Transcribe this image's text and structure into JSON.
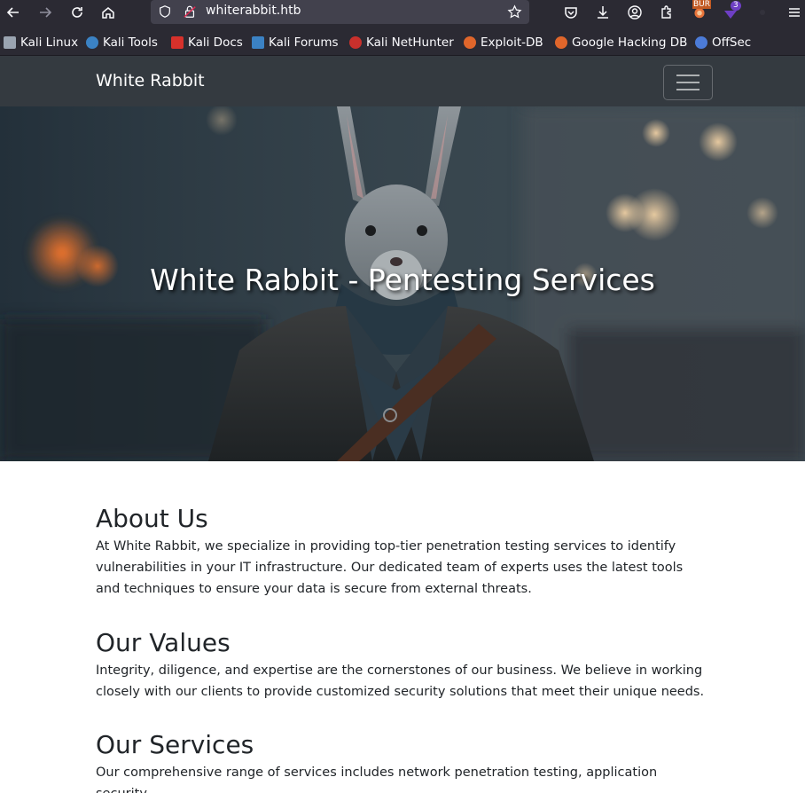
{
  "browser": {
    "url": "whiterabbit.htb",
    "extension_badge_count": "3",
    "burp_label": "BUR"
  },
  "bookmarks": [
    {
      "label": "Kali Linux",
      "icon": "kali-dragon-icon",
      "color": "#9aa4b1"
    },
    {
      "label": "Kali Tools",
      "icon": "kali-tools-icon",
      "color": "#3b82c4"
    },
    {
      "label": "Kali Docs",
      "icon": "kali-docs-icon",
      "color": "#d6312b"
    },
    {
      "label": "Kali Forums",
      "icon": "kali-forums-icon",
      "color": "#3b82c4"
    },
    {
      "label": "Kali NetHunter",
      "icon": "nethunter-icon",
      "color": "#c9302c"
    },
    {
      "label": "Exploit-DB",
      "icon": "exploitdb-icon",
      "color": "#e0662b"
    },
    {
      "label": "Google Hacking DB",
      "icon": "ghdb-icon",
      "color": "#e0662b"
    },
    {
      "label": "OffSec",
      "icon": "offsec-icon",
      "color": "#4c7bd8"
    }
  ],
  "navbar": {
    "brand": "White Rabbit"
  },
  "hero": {
    "title": "White Rabbit - Pentesting Services"
  },
  "sections": {
    "about": {
      "heading": "About Us",
      "text": "At White Rabbit, we specialize in providing top-tier penetration testing services to identify vulnerabilities in your IT infrastructure. Our dedicated team of experts uses the latest tools and techniques to ensure your data is secure from external threats."
    },
    "values": {
      "heading": "Our Values",
      "text": "Integrity, diligence, and expertise are the cornerstones of our business. We believe in working closely with our clients to provide customized security solutions that meet their unique needs."
    },
    "services": {
      "heading": "Our Services",
      "text": "Our comprehensive range of services includes network penetration testing, application security"
    }
  }
}
